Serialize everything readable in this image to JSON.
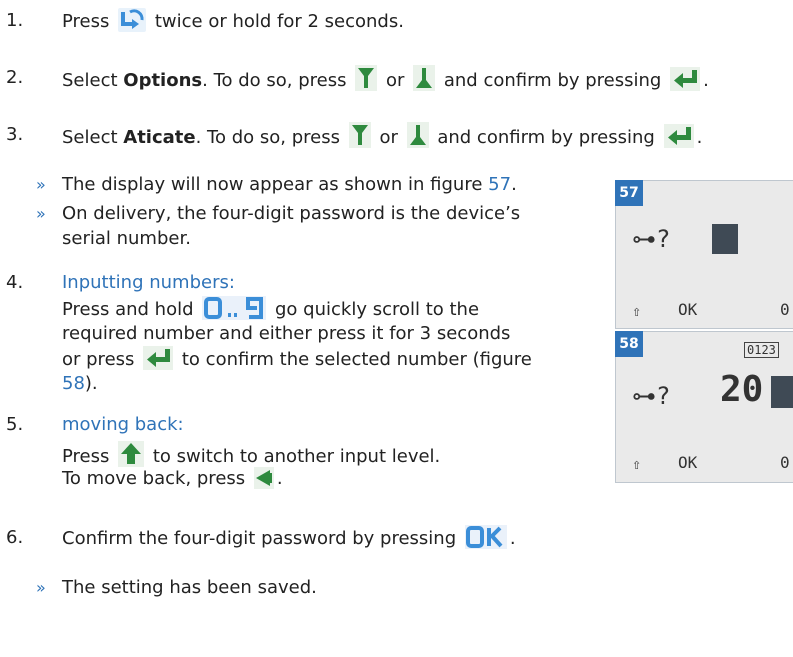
{
  "steps": [
    {
      "num": "1.",
      "text_a": "Press",
      "text_b": "twice or hold for 2 seconds."
    },
    {
      "num": "2.",
      "text_a": "Select",
      "bold": "Options",
      "text_b": ". To do so, press",
      "or": "or",
      "text_c": "and confirm by pressing",
      "end": "."
    },
    {
      "num": "3.",
      "text_a": "Select",
      "bold": "Aticate",
      "text_b": ". To do so, press",
      "or": "or",
      "text_c": "and confirm by pressing",
      "end": "."
    },
    {
      "num": "4.",
      "heading": "Inputting numbers:",
      "line1a": "Press and hold",
      "line1b": "go quickly scroll to the",
      "line2": "required number and either press it for 3 seconds",
      "line3a": "or press",
      "line3b": "to confirm the selected number (figure",
      "line4": "58",
      "line4end": ")."
    },
    {
      "num": "5.",
      "heading": "moving back:",
      "line1a": "Press",
      "line1b": "to switch to another input level.",
      "line2a": "To move back, press",
      "line2end": "."
    },
    {
      "num": "6.",
      "text_a": "Confirm the four-digit password by pressing",
      "end": "."
    }
  ],
  "notes": [
    {
      "arrow": "»",
      "text": "The display will now appear as shown in figure",
      "ref": "57",
      "end": "."
    },
    {
      "arrow": "»",
      "line1": "On delivery, the four-digit password is the device’s",
      "line2": "serial number."
    },
    {
      "arrow": "»",
      "text": "The setting has been saved."
    }
  ],
  "figures": [
    {
      "num": "57",
      "key": "⊶?",
      "left_soft": "⇧",
      "ok": "OK",
      "right_soft": "0"
    },
    {
      "num": "58",
      "key": "⊶?",
      "value": "20",
      "counter": "0123",
      "left_soft": "⇧",
      "ok": "OK",
      "right_soft": "0"
    }
  ],
  "icons": {
    "menu": "menu-key-icon",
    "down": "down-arrow-key-icon",
    "up": "up-arrow-key-icon",
    "enter": "enter-key-icon",
    "digits": "0..9",
    "shift": "shift-key-icon",
    "back": "back-key-icon",
    "ok": "OK"
  }
}
